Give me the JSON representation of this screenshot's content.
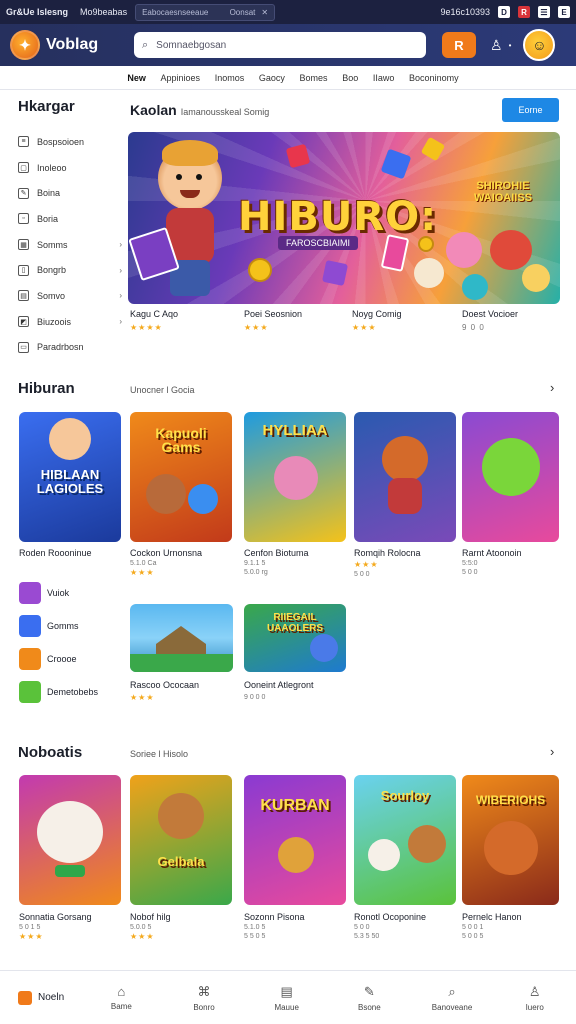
{
  "topbar": {
    "brand": "Gr&Ue Islesng",
    "link": "Mo9beabas",
    "search_text": "Eabocaesnseeaue",
    "search_btn": "Oonsat",
    "phone": "9e16c10393",
    "icons": [
      "d-icon",
      "r-icon",
      "b-icon",
      "e-icon"
    ]
  },
  "header": {
    "app_name": "Voblag",
    "search_placeholder": "Somnaebgosan",
    "r_button": "R",
    "avatar": "☺"
  },
  "nav": [
    "New",
    "Appinioes",
    "Inomos",
    "Gaocy",
    "Bomes",
    "Boo",
    "IIawo",
    "Boconinomy"
  ],
  "sidebar": {
    "title": "Hkargar",
    "items": [
      {
        "label": "Bospsoioen",
        "chev": ""
      },
      {
        "label": "Inoleoo",
        "chev": ""
      },
      {
        "label": "Boina",
        "chev": ""
      },
      {
        "label": "Boria",
        "chev": ""
      },
      {
        "label": "Somms",
        "chev": "›"
      },
      {
        "label": "Bongrb",
        "chev": "›"
      },
      {
        "label": "Somvo",
        "chev": "›"
      },
      {
        "label": "Biuzoois",
        "chev": "›"
      },
      {
        "label": "Paradrbosn",
        "chev": ""
      }
    ]
  },
  "featured": {
    "title": "Kaolan",
    "subtitle": "Iamanousskeal Somig",
    "button": "Eorne",
    "banner_title": "HIBURO:",
    "banner_plaque": "FAROSCBIAIMI",
    "banner_corner": "SHIROHIE WAIOAIISS",
    "captions": [
      {
        "title": "Kagu C Aqo",
        "stars": "★★★★"
      },
      {
        "title": "Poei Seosnion",
        "stars": "★★★"
      },
      {
        "title": "Noyg Comig",
        "stars": "★★★"
      },
      {
        "title": "Doest Vocioer",
        "stars": "9 0 0"
      }
    ]
  },
  "hiburan": {
    "title": "Hiburan",
    "subtitle": "Unocner l Gocia",
    "arrow": "›",
    "cards": [
      {
        "text": "HIBLAAN LAGIOLES",
        "title": "Roden Roooninue",
        "meta": "",
        "stars": ""
      },
      {
        "text": "Kapuoli Gams",
        "title": "Cockon Urnonsna",
        "meta": "5.1.0 Ca",
        "stars": "★★★"
      },
      {
        "text": "HYLLIAA",
        "title": "Cenfon Biotuma",
        "meta": "9.1.1 5",
        "stars": "5.0.0 rg"
      },
      {
        "text": "",
        "title": "Romqih Rolocna",
        "meta": "★★★",
        "stars": "5 0 0"
      },
      {
        "text": "",
        "title": "Rarnt Atoonoin",
        "meta": "5:5:0",
        "stars": "5 0 0"
      }
    ],
    "mini": [
      "Vuiok",
      "Gomms",
      "Croooe",
      "Demetobebs"
    ],
    "cards2": [
      {
        "text": "",
        "title": "Rascoo Ococaan",
        "meta": "★★★"
      },
      {
        "text": "RIIEGAIL UAAOLERS",
        "title": "Ooneint Atlegront",
        "meta": "9 0 0 0"
      }
    ]
  },
  "noboatis": {
    "title": "Noboatis",
    "subtitle": "Soriee l Hisolo",
    "arrow": "›",
    "cards": [
      {
        "text": "",
        "title": "Sonnatia Gorsang",
        "meta": "5 0 1 5",
        "stars": "★★★"
      },
      {
        "text": "GelbaIa",
        "title": "Nobof hilg",
        "meta": "5.0.0 5",
        "stars": "★★★"
      },
      {
        "text": "KURBAN",
        "title": "Sozonn Pisona",
        "meta": "5.1.0 5",
        "stars": "5 5 0 5"
      },
      {
        "text": "Sourloy",
        "title": "Ronotl Ocoponine",
        "meta": "5 0 0",
        "stars": "5.3 5 50"
      },
      {
        "text": "WIBERIOHS",
        "title": "Pernelc Hanon",
        "meta": "5 0 0 1",
        "stars": "5 0 0 5"
      }
    ]
  },
  "bottom_nav": {
    "home": "Noeln",
    "items": [
      {
        "label": "Bame",
        "icon": "⌂"
      },
      {
        "label": "Bonro",
        "icon": "⌘"
      },
      {
        "label": "Mauue",
        "icon": "▤"
      },
      {
        "label": "Bsone",
        "icon": "✎"
      },
      {
        "label": "Banoveane",
        "icon": "⌕"
      },
      {
        "label": "Iuero",
        "icon": "♙"
      }
    ]
  },
  "colors": {
    "accent": "#1e88e5",
    "orange": "#f07a1a",
    "header_bg": "#26305e",
    "star": "#f4a91c"
  }
}
